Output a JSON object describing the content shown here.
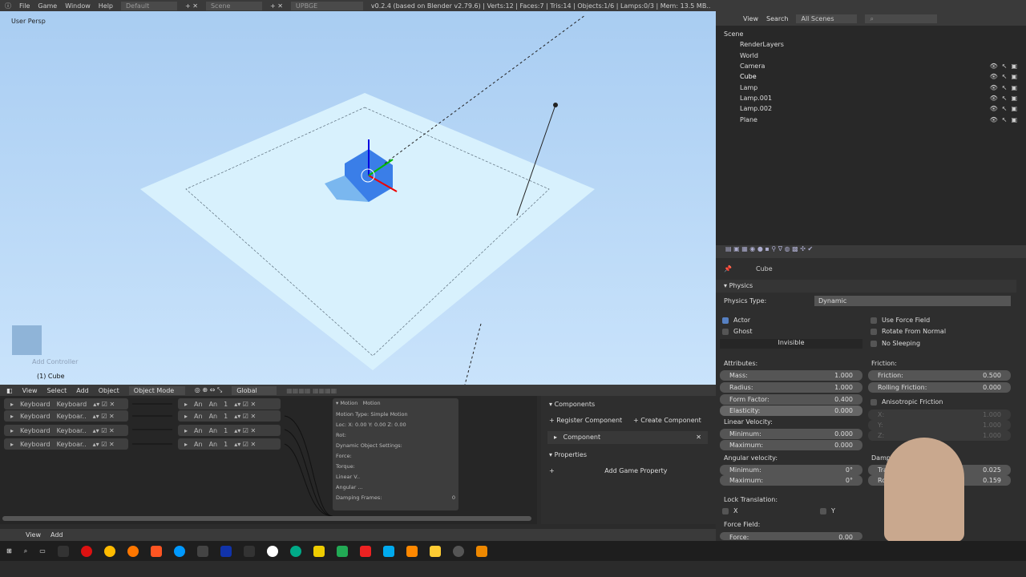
{
  "topbar": {
    "menus": [
      "File",
      "Game",
      "Window",
      "Help"
    ],
    "layout": "Default",
    "scene": "Scene",
    "engine": "UPBGE",
    "status": "v0.2.4 (based on Blender v2.79.6) | Verts:12 | Faces:7 | Tris:14 | Objects:1/6 | Lamps:0/3 | Mem: 13.5 MB.."
  },
  "viewport": {
    "view_label": "User Persp",
    "object_label": "(1) Cube",
    "hint": "Add Controller"
  },
  "outliner": {
    "menus": [
      "View",
      "Search"
    ],
    "scenes": "All Scenes",
    "items": [
      "Scene",
      "RenderLayers",
      "World",
      "Camera",
      "Cube",
      "Lamp",
      "Lamp.001",
      "Lamp.002",
      "Plane"
    ]
  },
  "props": {
    "object": "Cube",
    "panel": "Physics",
    "physics_type_label": "Physics Type:",
    "physics_type": "Dynamic",
    "actor": "Actor",
    "ghost": "Ghost",
    "invisible": "Invisible",
    "use_force_field": "Use Force Field",
    "rotate_from_normal": "Rotate From Normal",
    "no_sleeping": "No Sleeping",
    "attributes": "Attributes:",
    "mass": [
      "Mass:",
      "1.000"
    ],
    "radius": [
      "Radius:",
      "1.000"
    ],
    "form_factor": [
      "Form Factor:",
      "0.400"
    ],
    "elasticity": [
      "Elasticity:",
      "0.000"
    ],
    "friction_title": "Friction:",
    "friction": [
      "Friction:",
      "0.500"
    ],
    "rolling": [
      "Rolling Friction:",
      "0.000"
    ],
    "aniso": "Anisotropic Friction",
    "ax": [
      "X:",
      "1.000"
    ],
    "ay": [
      "Y:",
      "1.000"
    ],
    "az": [
      "Z:",
      "1.000"
    ],
    "linvel": "Linear Velocity:",
    "lmin": [
      "Minimum:",
      "0.000"
    ],
    "lmax": [
      "Maximum:",
      "0.000"
    ],
    "angvel": "Angular velocity:",
    "amin": [
      "Minimum:",
      "0°"
    ],
    "amax": [
      "Maximum:",
      "0°"
    ],
    "damping": "Damping:",
    "dtrans": [
      "Translation:",
      "0.025"
    ],
    "drot": [
      "Rotation:",
      "0.159"
    ],
    "lock": "Lock Translation:",
    "lx": "X",
    "ly": "Y",
    "forcefield": "Force Field:",
    "force": [
      "Force:",
      "0.00"
    ]
  },
  "logic": {
    "menus": [
      "View",
      "Select",
      "Add",
      "Object"
    ],
    "mode": "Object Mode",
    "orient": "Global",
    "sensors": [
      [
        "Keyboard",
        "Keyboard"
      ],
      [
        "Keyboard",
        "Keyboar.."
      ],
      [
        "Keyboard",
        "Keyboar.."
      ],
      [
        "Keyboard",
        "Keyboar.."
      ]
    ],
    "controllers": [
      [
        "An",
        "An",
        "1"
      ],
      [
        "An",
        "An",
        "1"
      ],
      [
        "An",
        "An",
        "1"
      ],
      [
        "An",
        "An",
        "1"
      ]
    ],
    "actuator": {
      "type": "Motion",
      "name": "Motion",
      "motion_type_label": "Motion Type:",
      "motion_type": "Simple Motion",
      "rows": [
        "Loc:",
        "Rot:",
        "Force:",
        "Torque:",
        "Linear V..",
        "Angular ..."
      ],
      "dyn": "Dynamic Object Settings:",
      "damping": "Damping Frames:",
      "damping_val": "0",
      "xyz": "X: 0.00   Y: 0.00   Z: 0.00"
    },
    "footer": [
      "View",
      "Add"
    ]
  },
  "components": {
    "title": "Components",
    "register": "Register Component",
    "create": "Create Component",
    "component": "Component",
    "properties": "Properties",
    "add_prop": "Add Game Property"
  }
}
